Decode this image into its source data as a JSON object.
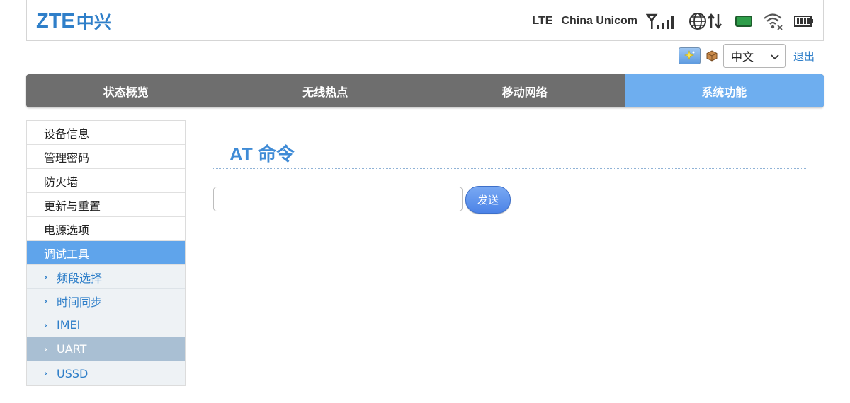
{
  "header": {
    "logo_latin": "ZTE",
    "logo_cn": "中兴",
    "network_type": "LTE",
    "carrier": "China Unicom",
    "icons": [
      "signal-strength-icon",
      "globe-data-icon",
      "sim-card-icon",
      "wifi-off-icon",
      "battery-icon"
    ]
  },
  "topbar": {
    "language": "中文",
    "logout": "退出"
  },
  "mainnav": {
    "tabs": [
      {
        "label": "状态概览"
      },
      {
        "label": "无线热点"
      },
      {
        "label": "移动网络"
      },
      {
        "label": "系统功能"
      }
    ],
    "active_index": 3
  },
  "sidebar": {
    "items": [
      {
        "label": "设备信息"
      },
      {
        "label": "管理密码"
      },
      {
        "label": "防火墙"
      },
      {
        "label": "更新与重置"
      },
      {
        "label": "电源选项"
      },
      {
        "label": "调试工具"
      }
    ],
    "subitems": [
      {
        "label": "频段选择"
      },
      {
        "label": "时间同步"
      },
      {
        "label": "IMEI"
      },
      {
        "label": "UART"
      },
      {
        "label": "USSD"
      }
    ]
  },
  "main": {
    "title": "AT 命令",
    "input_value": "",
    "send_label": "发送"
  },
  "colors": {
    "accent": "#6eaeef",
    "brand": "#2f7fc9",
    "nav_bg": "#6e6e6e"
  }
}
